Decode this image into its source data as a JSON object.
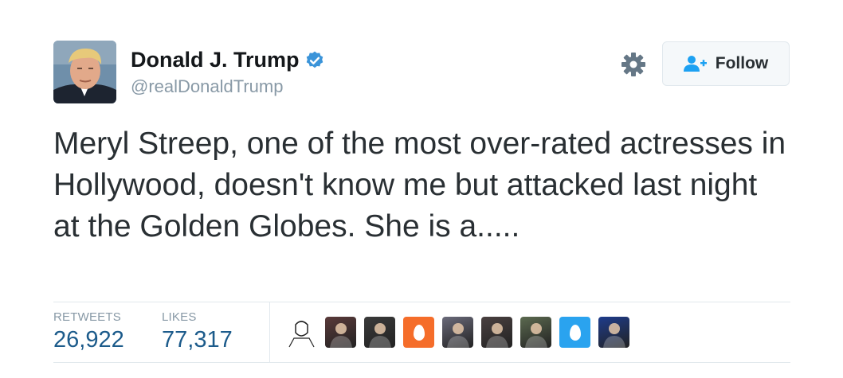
{
  "user": {
    "name": "Donald J. Trump",
    "handle": "@realDonaldTrump",
    "verified_color": "#3b94d9"
  },
  "actions": {
    "settings_icon": "gear-icon",
    "follow_label": "Follow",
    "follow_icon": "add-user-icon"
  },
  "tweet": {
    "text": "Meryl Streep, one of the most over-rated actresses in Hollywood, doesn't know me but attacked last night at the Golden Globes. She is a....."
  },
  "stats": {
    "retweets_label": "RETWEETS",
    "retweets_value": "26,922",
    "likes_label": "LIKES",
    "likes_value": "77,317"
  },
  "likers": [
    {
      "kind": "sketch"
    },
    {
      "kind": "photo",
      "color": "#5a3a3a"
    },
    {
      "kind": "photo",
      "color": "#3a3a3a"
    },
    {
      "kind": "egg",
      "color": "#f56d2a"
    },
    {
      "kind": "photo",
      "color": "#6a6a7a"
    },
    {
      "kind": "photo",
      "color": "#4a4040"
    },
    {
      "kind": "photo",
      "color": "#5c6a50"
    },
    {
      "kind": "egg",
      "color": "#2aa3ef"
    },
    {
      "kind": "photo",
      "color": "#1e3c8c"
    }
  ]
}
